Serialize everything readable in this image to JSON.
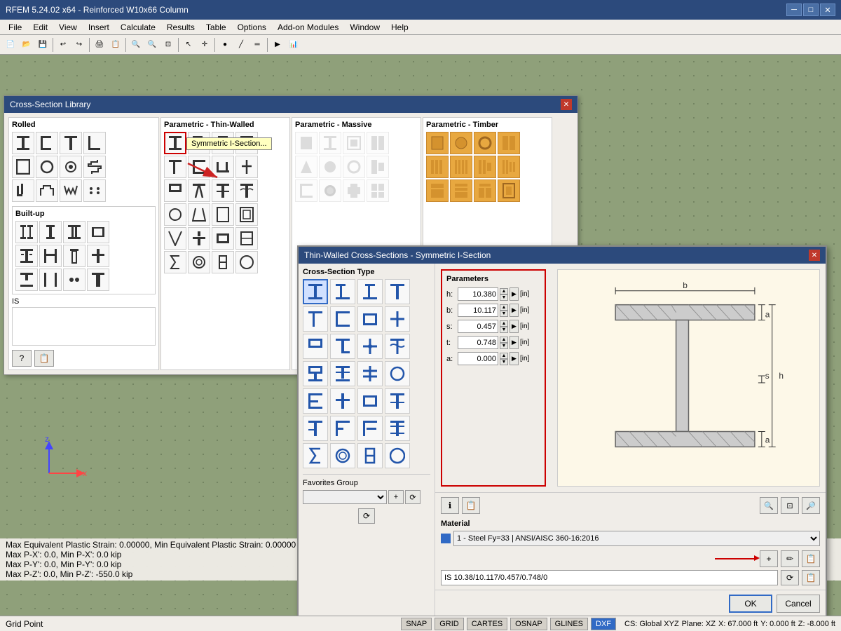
{
  "app": {
    "title": "RFEM 5.24.02 x64 - Reinforced W10x66 Column",
    "minimize_btn": "─",
    "maximize_btn": "□",
    "close_btn": "✕"
  },
  "menu": {
    "items": [
      "File",
      "Edit",
      "View",
      "Insert",
      "Calculate",
      "Results",
      "Table",
      "Options",
      "Add-on Modules",
      "Window",
      "Help"
    ]
  },
  "cs_library_dialog": {
    "title": "Cross-Section Library",
    "sections": {
      "rolled": {
        "label": "Rolled",
        "shapes": [
          "Ⅰ",
          "⊏",
          "⊤",
          "⊢",
          "□",
          "○",
          "◁",
          "⌐",
          "⌐",
          "Ψ",
          "ω",
          "∴"
        ]
      },
      "parametric_thin": {
        "label": "Parametric - Thin-Walled",
        "tooltip": "Symmetric I-Section..."
      },
      "parametric_massive": {
        "label": "Parametric - Massive"
      },
      "parametric_timber": {
        "label": "Parametric - Timber"
      },
      "built_up": {
        "label": "Built-up"
      }
    },
    "is_label": "IS",
    "footer_btns": [
      "?",
      "📋"
    ]
  },
  "thin_walled_dialog": {
    "title": "Thin-Walled Cross-Sections - Symmetric I-Section",
    "cross_section_type_label": "Cross-Section Type",
    "parameters_label": "Parameters",
    "params": {
      "h": {
        "label": "h:",
        "value": "10.380",
        "unit": "[in]"
      },
      "b": {
        "label": "b:",
        "value": "10.117",
        "unit": "[in]"
      },
      "s": {
        "label": "s:",
        "value": "0.457",
        "unit": "[in]"
      },
      "t": {
        "label": "t:",
        "value": "0.748",
        "unit": "[in]"
      },
      "a": {
        "label": "a:",
        "value": "0.000",
        "unit": "[in]"
      }
    },
    "material_label": "Material",
    "material_value": "1 - Steel Fy=33 | ANSI/AISC 360-16:2016",
    "section_name": "IS 10.38/10.117/0.457/0.748/0",
    "favorites_group_label": "Favorites Group",
    "ok_label": "OK",
    "cancel_label": "Cancel"
  },
  "status_bar": {
    "status_text": "Grid Point",
    "items": [
      "SNAP",
      "GRID",
      "CARTES",
      "OSNAP",
      "GLINES",
      "DXF"
    ],
    "active_item": "DXF",
    "cs_info": "CS: Global XYZ",
    "plane_info": "Plane: XZ",
    "x_coord": "X: 67.000 ft",
    "y_coord": "Y: 0.000 ft",
    "z_coord": "Z: -8.000 ft"
  },
  "bottom_labels": {
    "line1": "Max Equivalent Plastic Strain: 0.00000, Min Equivalent Plastic Strain: 0.00000 -",
    "line2": "Max P-X': 0.0, Min P-X': 0.0 kip",
    "line3": "Max P-Y': 0.0, Min P-Y': 0.0 kip",
    "line4": "Max P-Z': 0.0, Min P-Z': -550.0 kip"
  }
}
